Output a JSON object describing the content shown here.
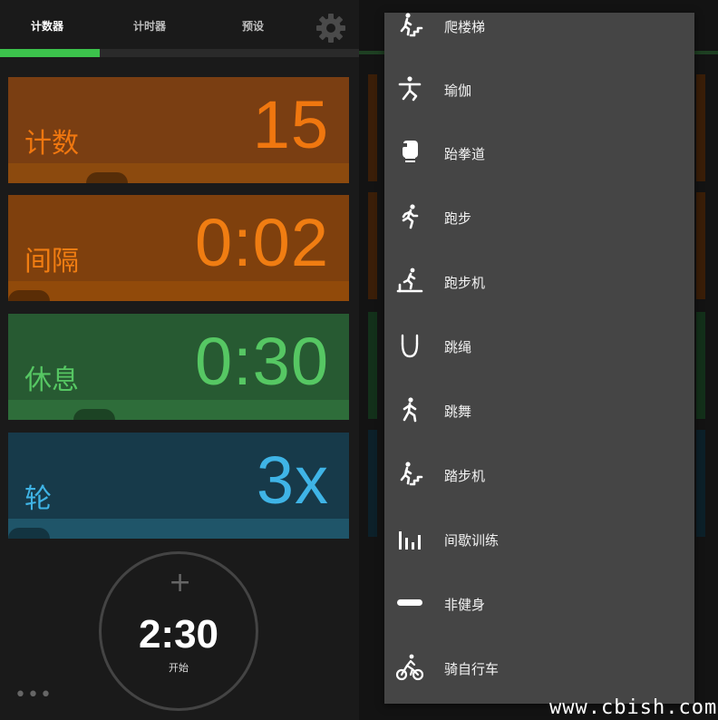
{
  "tabs": [
    {
      "label": "计数器",
      "active": true
    },
    {
      "label": "计时器",
      "active": false
    },
    {
      "label": "预设",
      "active": false
    }
  ],
  "cards": [
    {
      "label": "计数",
      "value": "15",
      "bg": "#7a3e12",
      "band": "#8c4a0e",
      "fg": "#f0770f"
    },
    {
      "label": "间隔",
      "value": "0:02",
      "bg": "#7f400d",
      "band": "#914a0a",
      "fg": "#f07d12"
    },
    {
      "label": "休息",
      "value": "0:30",
      "bg": "#275a32",
      "band": "#2e6d3a",
      "fg": "#56c763"
    },
    {
      "label": "轮",
      "value": "3x",
      "bg": "#173a4a",
      "band": "#1f5569",
      "fg": "#3fb4e6"
    }
  ],
  "timer": {
    "time": "2:30",
    "start_label": "开始",
    "plus": "+"
  },
  "more": "•••",
  "menu": {
    "items": [
      {
        "label": "爬楼梯",
        "icon": "stairs-climb-icon"
      },
      {
        "label": "瑜伽",
        "icon": "yoga-icon"
      },
      {
        "label": "跆拳道",
        "icon": "boxing-glove-icon"
      },
      {
        "label": "跑步",
        "icon": "running-icon"
      },
      {
        "label": "跑步机",
        "icon": "treadmill-icon"
      },
      {
        "label": "跳绳",
        "icon": "jump-rope-icon"
      },
      {
        "label": "跳舞",
        "icon": "dance-icon"
      },
      {
        "label": "踏步机",
        "icon": "stepper-icon"
      },
      {
        "label": "间歇训练",
        "icon": "interval-bars-icon"
      },
      {
        "label": "非健身",
        "icon": "minus-bar-icon"
      },
      {
        "label": "骑自行车",
        "icon": "cycling-icon"
      }
    ]
  },
  "watermark": "www.cbish.com"
}
